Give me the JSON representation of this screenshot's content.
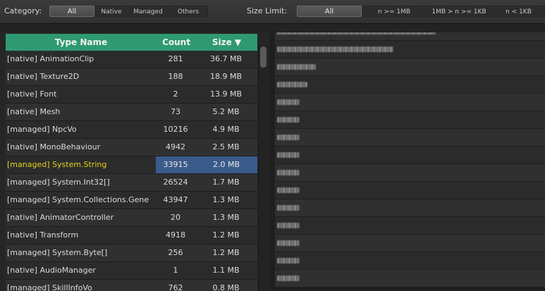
{
  "toolbar": {
    "category_label": "Category:",
    "category_buttons": [
      "All",
      "Native",
      "Managed",
      "Others"
    ],
    "category_active": "All",
    "size_limit_label": "Size Limit:",
    "size_buttons": [
      "All",
      "n >= 1MB",
      "1MB > n >= 1KB",
      "n < 1KB"
    ],
    "size_active": "All"
  },
  "table": {
    "columns": [
      "Type Name",
      "Count",
      "Size ▼"
    ],
    "sort_column": "Size",
    "sort_direction": "descending",
    "selected_row": 6,
    "rows": [
      {
        "name": "[native] AnimationClip",
        "count": "281",
        "size": "36.7 MB"
      },
      {
        "name": "[native] Texture2D",
        "count": "188",
        "size": "18.9 MB"
      },
      {
        "name": "[native] Font",
        "count": "2",
        "size": "13.9 MB"
      },
      {
        "name": "[native] Mesh",
        "count": "73",
        "size": "5.2 MB"
      },
      {
        "name": "[managed] NpcVo",
        "count": "10216",
        "size": "4.9 MB"
      },
      {
        "name": "[native] MonoBehaviour",
        "count": "4942",
        "size": "2.5 MB"
      },
      {
        "name": "[managed] System.String",
        "count": "33915",
        "size": "2.0 MB"
      },
      {
        "name": "[managed] System.Int32[]",
        "count": "26524",
        "size": "1.7 MB"
      },
      {
        "name": "[managed] System.Collections.Gene",
        "count": "43947",
        "size": "1.3 MB"
      },
      {
        "name": "[native] AnimatorController",
        "count": "20",
        "size": "1.3 MB"
      },
      {
        "name": "[native] Transform",
        "count": "4918",
        "size": "1.2 MB"
      },
      {
        "name": "[managed] System.Byte[]",
        "count": "256",
        "size": "1.2 MB"
      },
      {
        "name": "[native] AudioManager",
        "count": "1",
        "size": "1.1 MB"
      },
      {
        "name": "[managed] SkillInfoVo",
        "count": "762",
        "size": "0.8 MB"
      }
    ]
  },
  "colors": {
    "header_green": "#2f9a72",
    "selection_blue": "#3a5a8a",
    "selected_text_yellow": "#e5d21e"
  }
}
